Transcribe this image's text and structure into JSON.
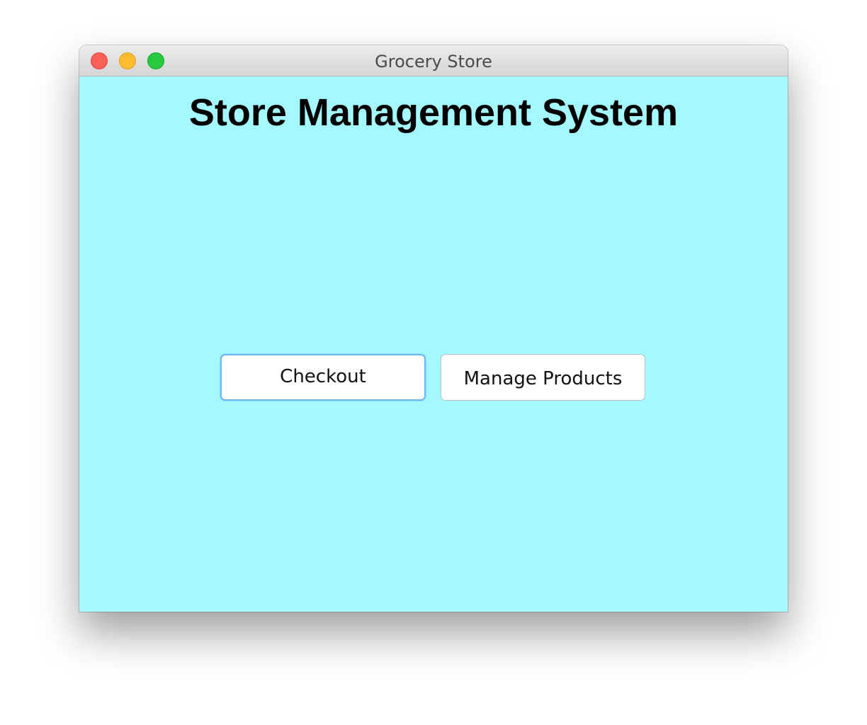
{
  "window": {
    "title": "Grocery Store"
  },
  "main": {
    "heading": "Store Management System",
    "buttons": {
      "checkout_label": "Checkout",
      "manage_products_label": "Manage Products"
    }
  },
  "colors": {
    "background": "#a3f9ff",
    "focus_ring": "#6eb5f5",
    "close": "#fe5f57",
    "minimize": "#febc2e",
    "zoom": "#28c840"
  }
}
